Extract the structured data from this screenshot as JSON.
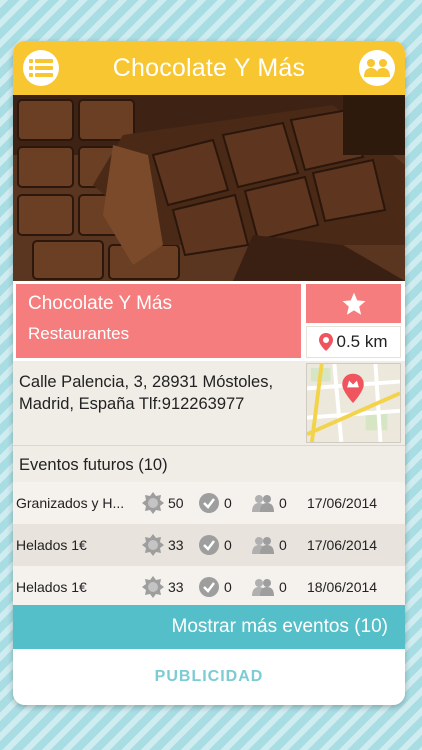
{
  "header": {
    "title": "Chocolate Y Más",
    "menu_icon": "list-icon",
    "social_icon": "group-icon"
  },
  "venue": {
    "name": "Chocolate Y Más",
    "category": "Restaurantes",
    "favorite_icon": "star-icon",
    "distance": "0.5 km",
    "address_line1": "Calle Palencia, 3, 28931 Móstoles,",
    "address_line2": "Madrid, España Tlf:912263977"
  },
  "events": {
    "title": "Eventos futuros (10)",
    "rows": [
      {
        "name": "Granizados y H...",
        "score": "50",
        "checks": "0",
        "people": "0",
        "date": "17/06/2014"
      },
      {
        "name": "Helados 1€",
        "score": "33",
        "checks": "0",
        "people": "0",
        "date": "17/06/2014"
      },
      {
        "name": "Helados 1€",
        "score": "33",
        "checks": "0",
        "people": "0",
        "date": "18/06/2014"
      }
    ],
    "more_label": "Mostrar más eventos (10)"
  },
  "ad": {
    "label": "PUBLICIDAD"
  },
  "colors": {
    "header": "#f7c630",
    "accent_red": "#f57d7d",
    "teal": "#54bfc9",
    "background": "#a8dde3"
  }
}
